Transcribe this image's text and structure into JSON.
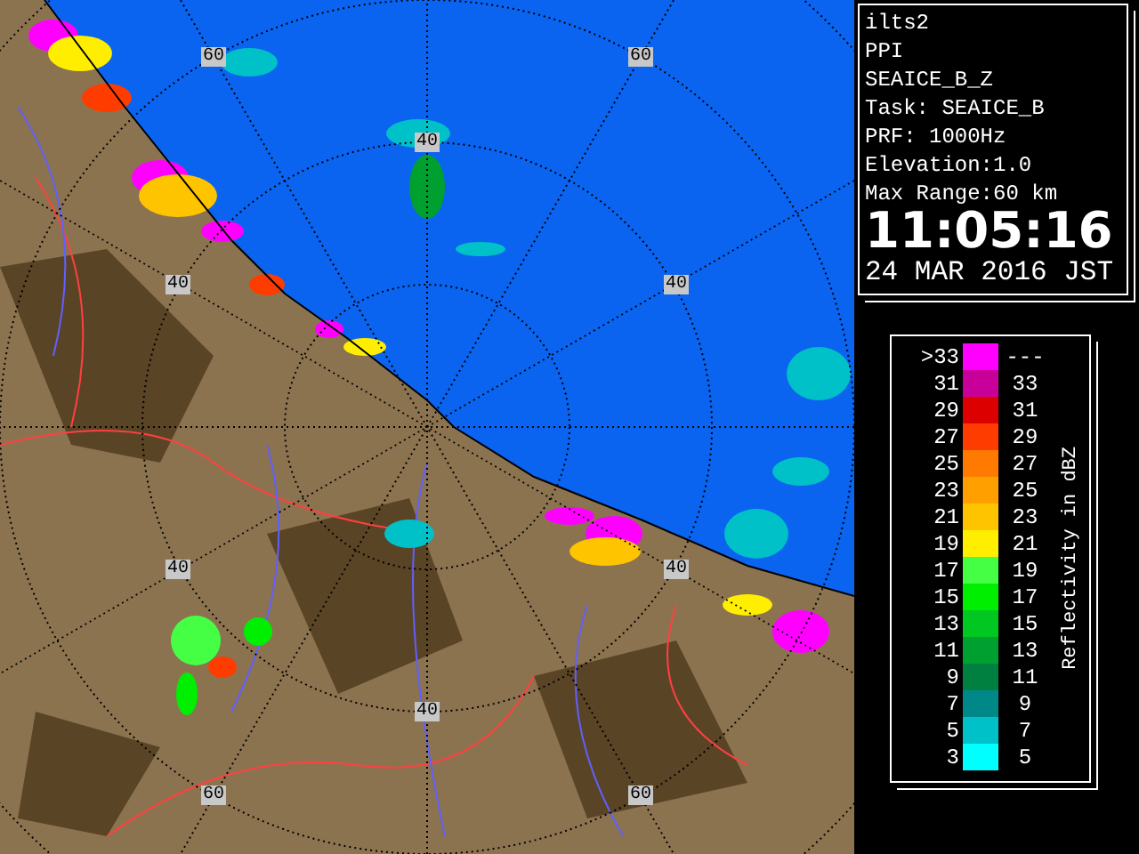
{
  "map": {
    "range_labels": [
      "60",
      "60",
      "40",
      "40",
      "40",
      "40",
      "40",
      "40",
      "60",
      "60"
    ]
  },
  "info": {
    "lines": [
      "ilts2",
      "PPI",
      "SEAICE_B_Z",
      "Task: SEAICE_B",
      "PRF: 1000Hz",
      "Elevation:1.0",
      "Max Range:60 km"
    ],
    "time": "11:05:16",
    "date": "24 MAR 2016 JST"
  },
  "legend": {
    "axis_label": "Reflectivity in dBZ",
    "rows": [
      {
        "low": ">33",
        "high": "---",
        "color": "#ff00ff"
      },
      {
        "low": "31",
        "high": "33",
        "color": "#c8009a"
      },
      {
        "low": "29",
        "high": "31",
        "color": "#dd0000"
      },
      {
        "low": "27",
        "high": "29",
        "color": "#ff3c00"
      },
      {
        "low": "25",
        "high": "27",
        "color": "#ff7a00"
      },
      {
        "low": "23",
        "high": "25",
        "color": "#ffa000"
      },
      {
        "low": "21",
        "high": "23",
        "color": "#ffc400"
      },
      {
        "low": "19",
        "high": "21",
        "color": "#ffee00"
      },
      {
        "low": "17",
        "high": "19",
        "color": "#44ff44"
      },
      {
        "low": "15",
        "high": "17",
        "color": "#00ee00"
      },
      {
        "low": "13",
        "high": "15",
        "color": "#00c820"
      },
      {
        "low": "11",
        "high": "13",
        "color": "#00a030"
      },
      {
        "low": "9",
        "high": "11",
        "color": "#008040"
      },
      {
        "low": "7",
        "high": "9",
        "color": "#008888"
      },
      {
        "low": "5",
        "high": "7",
        "color": "#00c0c8"
      },
      {
        "low": "3",
        "high": "5",
        "color": "#00ffff"
      }
    ]
  }
}
